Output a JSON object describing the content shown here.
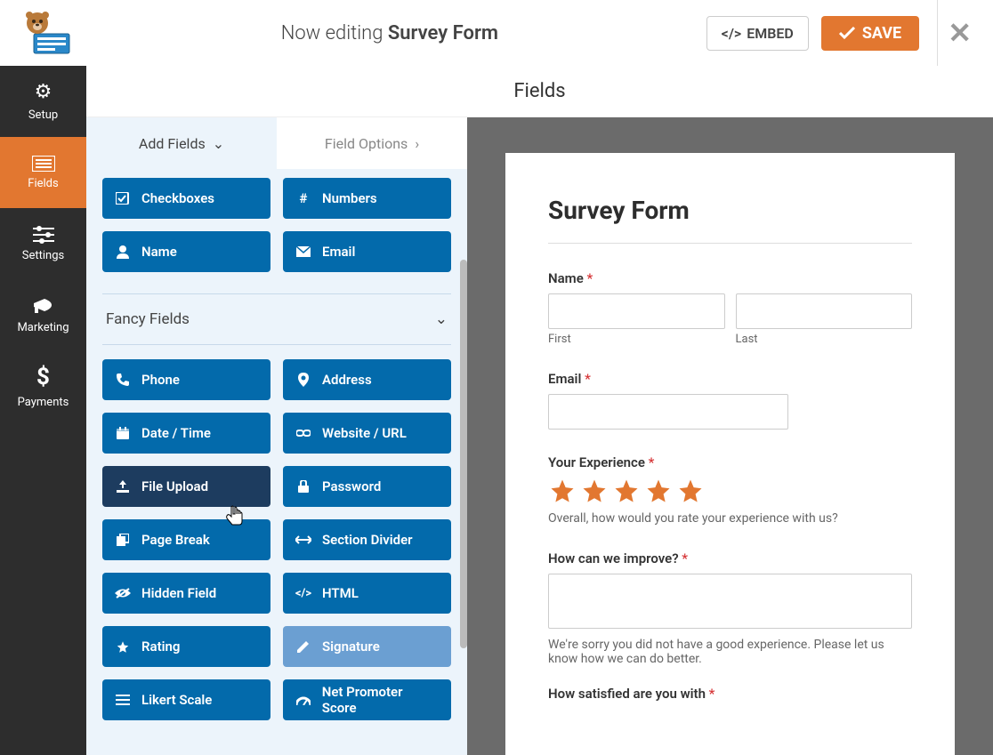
{
  "header": {
    "prefix": "Now editing ",
    "title": "Survey Form",
    "embed": "EMBED",
    "save": "SAVE"
  },
  "rail": [
    {
      "icon": "gear",
      "label": "Setup"
    },
    {
      "icon": "list",
      "label": "Fields"
    },
    {
      "icon": "sliders",
      "label": "Settings"
    },
    {
      "icon": "bullhorn",
      "label": "Marketing"
    },
    {
      "icon": "dollar",
      "label": "Payments"
    }
  ],
  "fieldsHeading": "Fields",
  "panelTabs": {
    "add": "Add Fields",
    "options": "Field Options"
  },
  "stdFields": [
    {
      "icon": "check",
      "label": "Checkboxes"
    },
    {
      "icon": "hash",
      "label": "Numbers"
    },
    {
      "icon": "person",
      "label": "Name"
    },
    {
      "icon": "envelope",
      "label": "Email"
    }
  ],
  "section": "Fancy Fields",
  "fancyFields": [
    {
      "icon": "phone",
      "label": "Phone"
    },
    {
      "icon": "pin",
      "label": "Address"
    },
    {
      "icon": "calendar",
      "label": "Date / Time"
    },
    {
      "icon": "link",
      "label": "Website / URL"
    },
    {
      "icon": "upload",
      "label": "File Upload",
      "state": "hover"
    },
    {
      "icon": "lock",
      "label": "Password"
    },
    {
      "icon": "copy",
      "label": "Page Break"
    },
    {
      "icon": "arrows",
      "label": "Section Divider"
    },
    {
      "icon": "eye",
      "label": "Hidden Field"
    },
    {
      "icon": "code",
      "label": "HTML"
    },
    {
      "icon": "star",
      "label": "Rating"
    },
    {
      "icon": "pencil",
      "label": "Signature",
      "state": "dim"
    },
    {
      "icon": "bars",
      "label": "Likert Scale"
    },
    {
      "icon": "gauge",
      "label": "Net Promoter Score"
    }
  ],
  "form": {
    "title": "Survey Form",
    "name": {
      "label": "Name",
      "first": "First",
      "last": "Last"
    },
    "email": {
      "label": "Email"
    },
    "exp": {
      "label": "Your Experience",
      "desc": "Overall, how would you rate your experience with us?"
    },
    "improve": {
      "label": "How can we improve?",
      "desc": "We're sorry you did not have a good experience. Please let us know how we can do better."
    },
    "satisfied": {
      "label": "How satisfied are you with"
    }
  }
}
